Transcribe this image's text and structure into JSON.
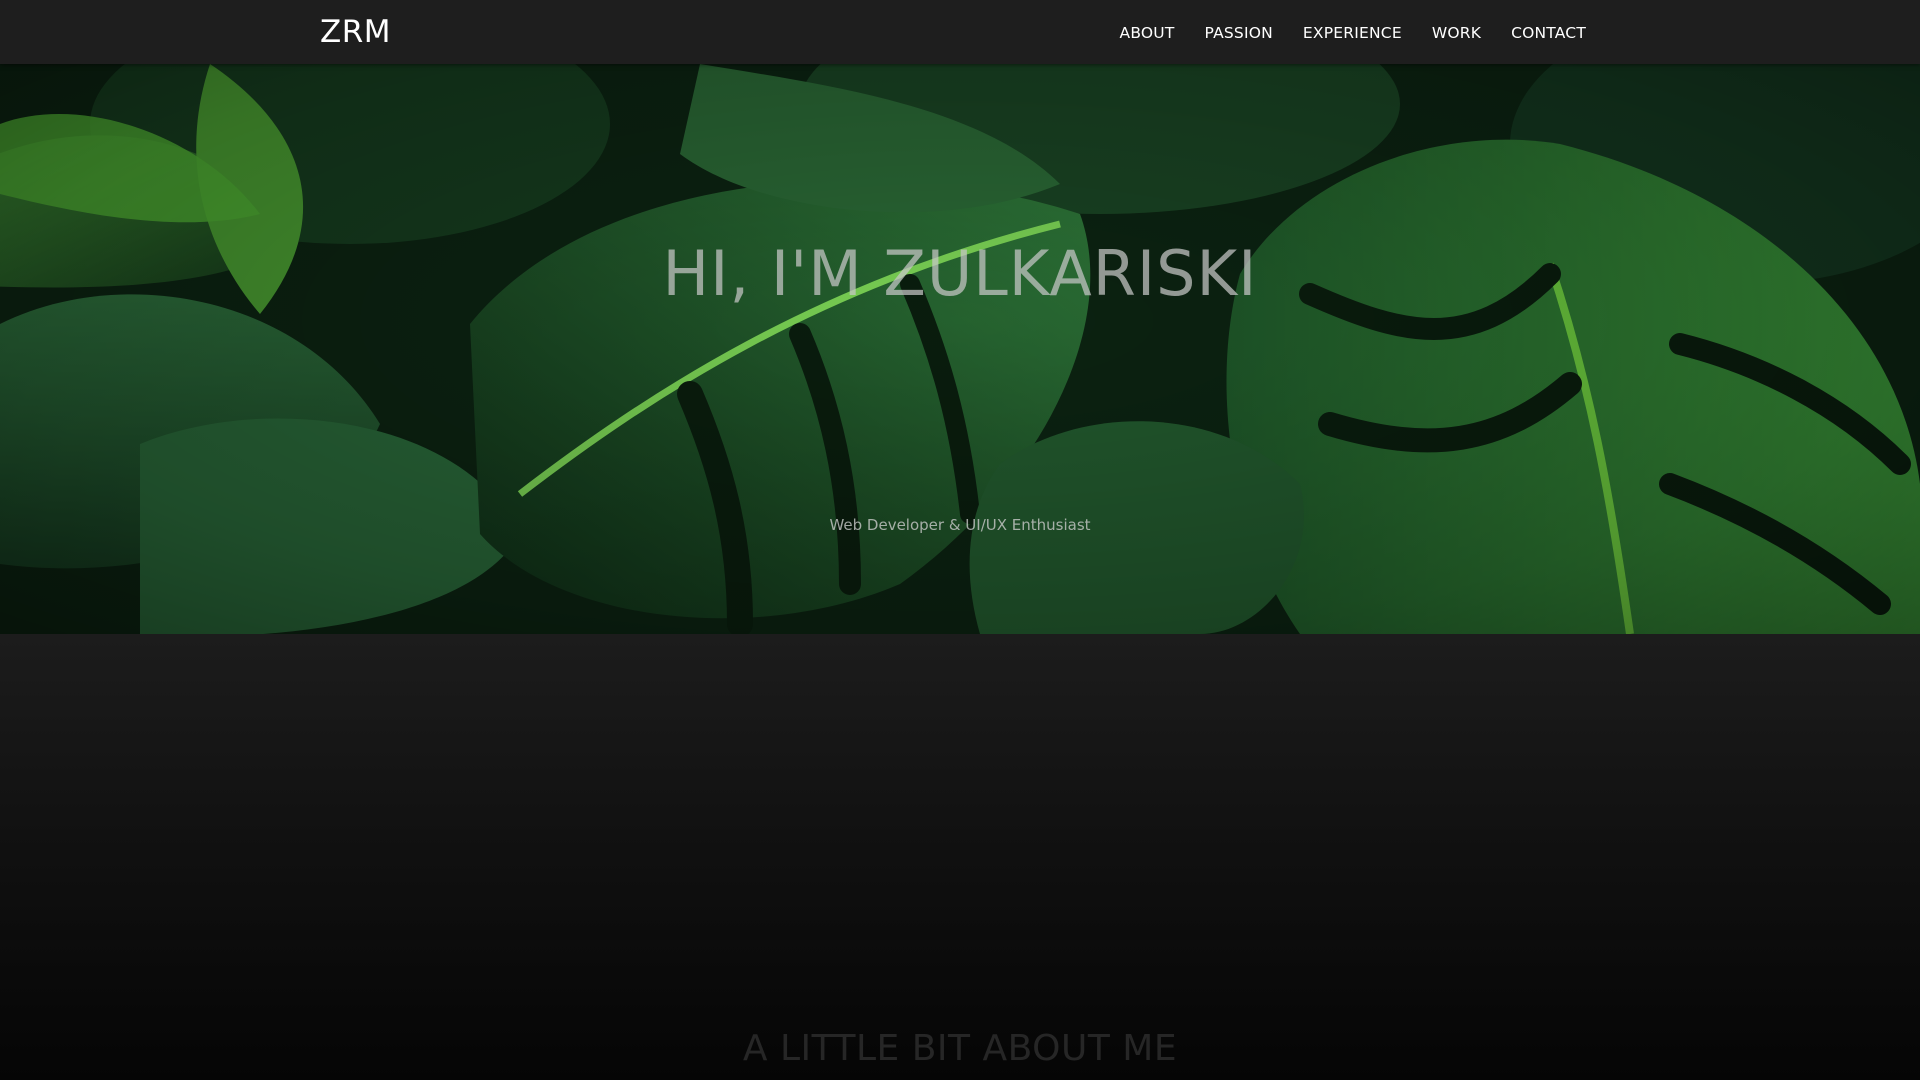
{
  "nav": {
    "brand": "ZRM",
    "items": [
      {
        "label": "ABOUT"
      },
      {
        "label": "PASSION"
      },
      {
        "label": "EXPERIENCE"
      },
      {
        "label": "WORK"
      },
      {
        "label": "CONTACT"
      }
    ]
  },
  "hero": {
    "title": "HI, I'M ZULKARISKI",
    "subtitle": "Web Developer & UI/UX Enthusiast",
    "background": "monstera-leaves-image"
  },
  "about": {
    "title": "A LITTLE BIT ABOUT ME"
  },
  "colors": {
    "navbar": "#1e1e1e",
    "nav_text": "#ffffff",
    "leaf_dark": "#163d1c",
    "leaf_mid": "#2e6b2c",
    "leaf_bright": "#5cbf2a",
    "section_bg": "#1c1c1c"
  }
}
